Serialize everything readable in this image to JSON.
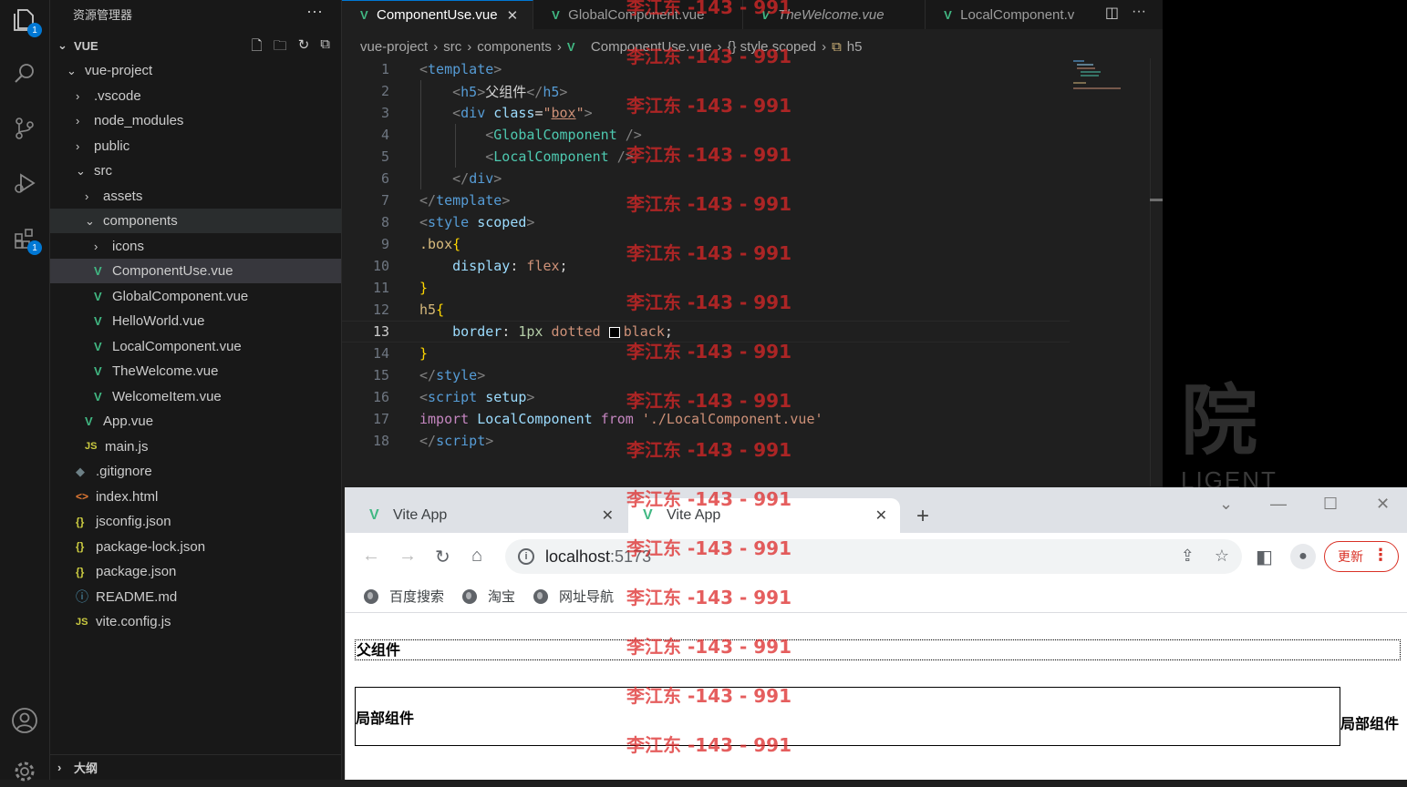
{
  "explorer": {
    "title": "资源管理器",
    "root": "VUE",
    "tree": [
      {
        "label": "vue-project",
        "type": "folder",
        "open": true
      },
      {
        "label": ".vscode",
        "type": "folder"
      },
      {
        "label": "node_modules",
        "type": "folder"
      },
      {
        "label": "public",
        "type": "folder"
      },
      {
        "label": "src",
        "type": "folder",
        "open": true
      },
      {
        "label": "assets",
        "type": "folder"
      },
      {
        "label": "components",
        "type": "folder",
        "open": true
      },
      {
        "label": "icons",
        "type": "folder"
      },
      {
        "label": "ComponentUse.vue",
        "type": "vue"
      },
      {
        "label": "GlobalComponent.vue",
        "type": "vue"
      },
      {
        "label": "HelloWorld.vue",
        "type": "vue"
      },
      {
        "label": "LocalComponent.vue",
        "type": "vue"
      },
      {
        "label": "TheWelcome.vue",
        "type": "vue"
      },
      {
        "label": "WelcomeItem.vue",
        "type": "vue"
      },
      {
        "label": "App.vue",
        "type": "vue"
      },
      {
        "label": "main.js",
        "type": "js"
      },
      {
        "label": ".gitignore",
        "type": "git"
      },
      {
        "label": "index.html",
        "type": "html"
      },
      {
        "label": "jsconfig.json",
        "type": "json"
      },
      {
        "label": "package-lock.json",
        "type": "json"
      },
      {
        "label": "package.json",
        "type": "json"
      },
      {
        "label": "README.md",
        "type": "info"
      },
      {
        "label": "vite.config.js",
        "type": "js"
      }
    ],
    "outline": "大纲"
  },
  "activity": {
    "badge_files": "1",
    "badge_ext": "1"
  },
  "editor": {
    "tabs": [
      {
        "label": "ComponentUse.vue",
        "active": true
      },
      {
        "label": "GlobalComponent.vue"
      },
      {
        "label": "TheWelcome.vue"
      },
      {
        "label": "LocalComponent.v"
      }
    ],
    "breadcrumb": [
      "vue-project",
      "src",
      "components",
      "ComponentUse.vue",
      "{} style scoped",
      "h5"
    ],
    "line_numbers": [
      "1",
      "2",
      "3",
      "4",
      "5",
      "6",
      "7",
      "8",
      "9",
      "10",
      "11",
      "12",
      "13",
      "14",
      "15",
      "16",
      "17",
      "18"
    ],
    "current_line": "13"
  },
  "rightpane": {
    "bigchar": "院",
    "ligent": "LIGENT"
  },
  "browser": {
    "tabs": [
      {
        "label": "Vite App"
      },
      {
        "label": "Vite App",
        "active": true
      }
    ],
    "url_host": "localhost",
    "url_port": ":5173",
    "update_label": "更新",
    "bookmarks": [
      "百度搜索",
      "淘宝",
      "网址导航"
    ],
    "page": {
      "h5": "父组件",
      "global": "局部组件",
      "local": "局部组件"
    }
  },
  "watermark": "李江东 -143 - 991"
}
